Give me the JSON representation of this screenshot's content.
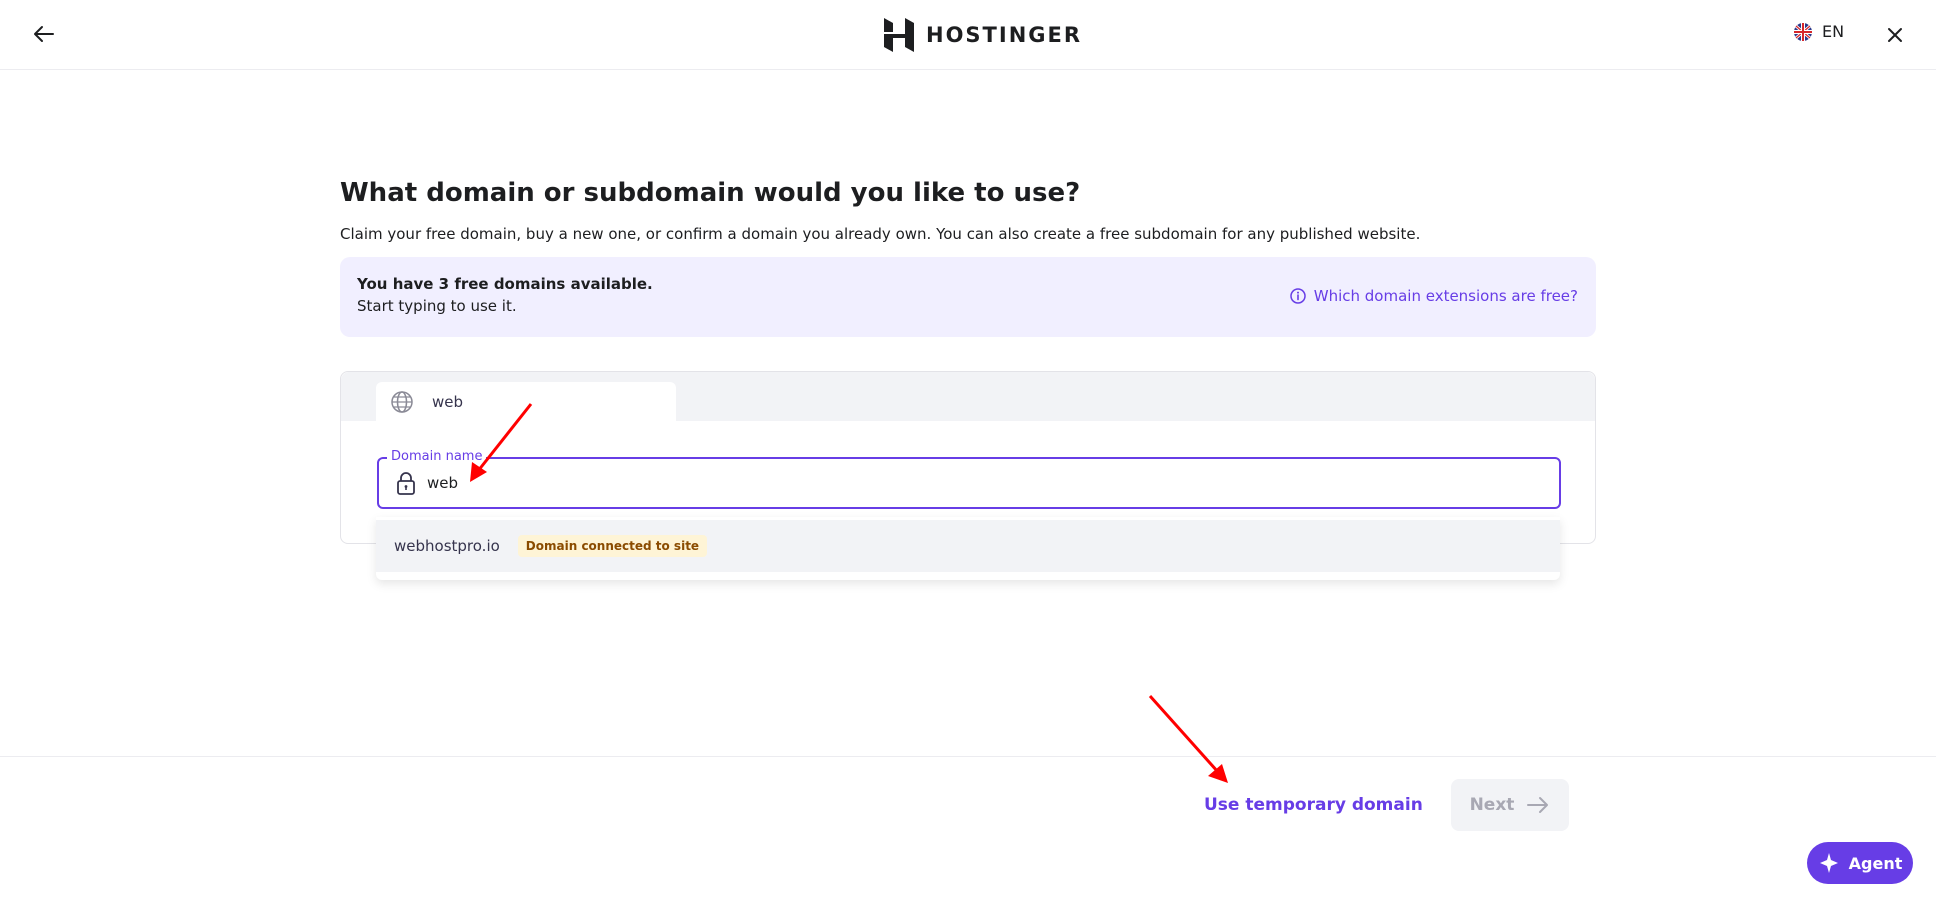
{
  "header": {
    "brand": "HOSTINGER",
    "language": "EN"
  },
  "main": {
    "title": "What domain or subdomain would you like to use?",
    "subtitle": "Claim your free domain, buy a new one, or confirm a domain you already own. You can also create a free subdomain for any published website.",
    "info_box": {
      "title": "You have 3 free domains available.",
      "subtitle": "Start typing to use it.",
      "link": "Which domain extensions are free?"
    },
    "tabs": [
      {
        "label": "web",
        "icon": "globe-icon"
      }
    ],
    "domain_field": {
      "label": "Domain name",
      "value": "web"
    },
    "suggestions": [
      {
        "domain": "webhostpro.io",
        "badge": "Domain connected to site"
      }
    ]
  },
  "footer": {
    "temp_domain": "Use temporary domain",
    "next": "Next",
    "agent": "Agent"
  },
  "colors": {
    "accent": "#673de6",
    "info_bg": "#f1efff",
    "badge_bg": "#fef4d6",
    "badge_text": "#8a4b00",
    "annotation": "#ff0000"
  }
}
